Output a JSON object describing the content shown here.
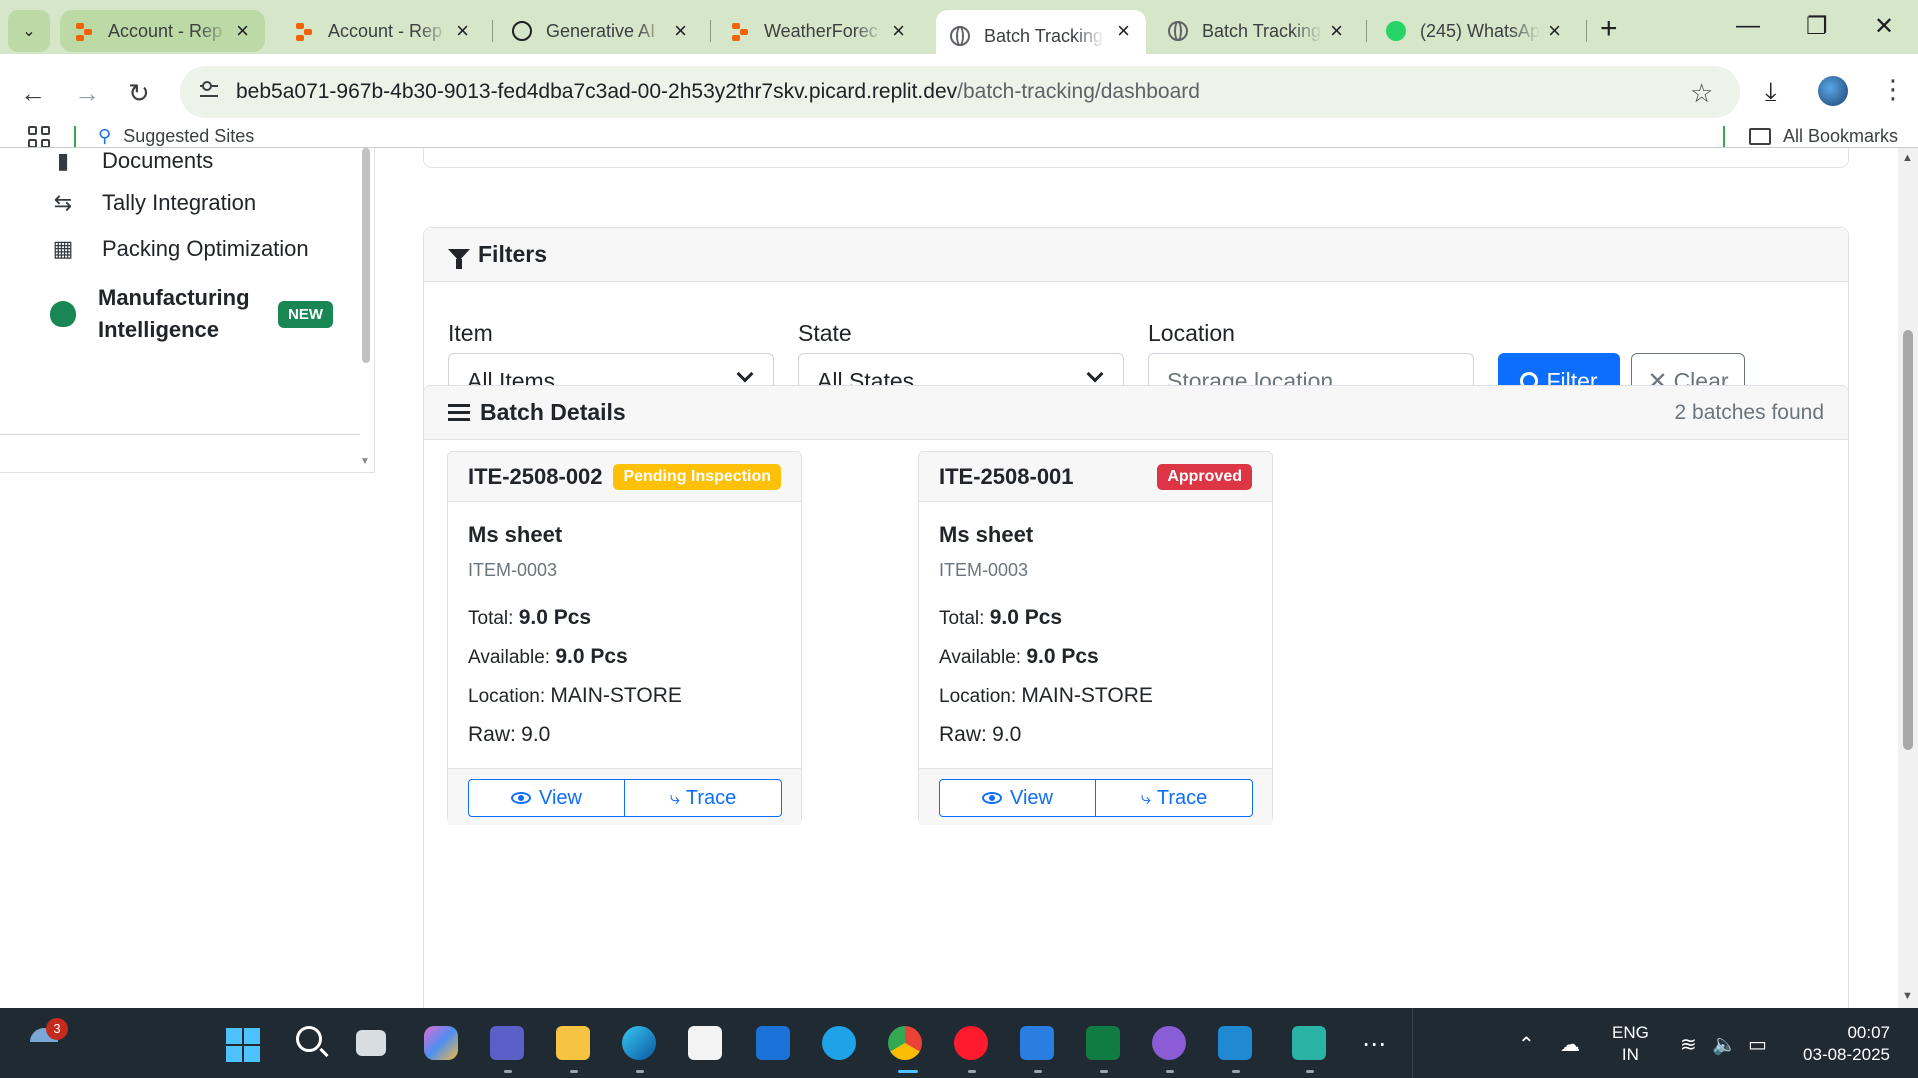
{
  "browser": {
    "tabs": [
      {
        "label": "Account - Rep",
        "icon": "replit-icon",
        "state": "highlighted"
      },
      {
        "label": "Account - Rep",
        "icon": "replit-icon",
        "state": "inactive"
      },
      {
        "label": "Generative AI",
        "icon": "openai-icon",
        "state": "inactive"
      },
      {
        "label": "WeatherForec",
        "icon": "replit-icon",
        "state": "inactive"
      },
      {
        "label": "Batch Tracking",
        "icon": "globe-icon",
        "state": "active"
      },
      {
        "label": "Batch Tracking",
        "icon": "globe-icon",
        "state": "inactive"
      },
      {
        "label": "(245) WhatsAp",
        "icon": "whatsapp-icon",
        "state": "inactive"
      }
    ],
    "url_host": "beb5a071-967b-4b30-9013-fed4dba7c3ad-00-2h53y2thr7skv.picard.replit.dev",
    "url_path": "/batch-tracking/dashboard",
    "bookmarks": {
      "suggested": "Suggested Sites",
      "all": "All Bookmarks"
    }
  },
  "sidebar": {
    "items": [
      {
        "label": "Documents",
        "icon": "file-icon"
      },
      {
        "label": "Tally Integration",
        "icon": "exchange-icon"
      },
      {
        "label": "Packing Optimization",
        "icon": "boxes-icon"
      }
    ],
    "mi_line1": "Manufacturing",
    "mi_line2": "Intelligence",
    "mi_badge": "NEW"
  },
  "filters": {
    "title": "Filters",
    "item_label": "Item",
    "item_value": "All Items",
    "state_label": "State",
    "state_value": "All States",
    "location_label": "Location",
    "location_placeholder": "Storage location",
    "filter_button": "Filter",
    "clear_button": "Clear"
  },
  "batch_details": {
    "title": "Batch Details",
    "count_text": "2 batches found",
    "batches": [
      {
        "batch_no": "ITE-2508-002",
        "status": "Pending Inspection",
        "status_color": "#ffc107",
        "item_name": "Ms sheet",
        "item_code": "ITEM-0003",
        "total_label": "Total:",
        "total": "9.0 Pcs",
        "available_label": "Available:",
        "available": "9.0 Pcs",
        "location_label": "Location:",
        "location": "MAIN-STORE",
        "raw_label": "Raw:",
        "raw": "9.0",
        "view": "View",
        "trace": "Trace"
      },
      {
        "batch_no": "ITE-2508-001",
        "status": "Approved",
        "status_color": "#dc3545",
        "item_name": "Ms sheet",
        "item_code": "ITEM-0003",
        "total_label": "Total:",
        "total": "9.0 Pcs",
        "available_label": "Available:",
        "available": "9.0 Pcs",
        "location_label": "Location:",
        "location": "MAIN-STORE",
        "raw_label": "Raw:",
        "raw": "9.0",
        "view": "View",
        "trace": "Trace"
      }
    ]
  },
  "taskbar": {
    "weather_badge": "3",
    "lang_line1": "ENG",
    "lang_line2": "IN",
    "time": "00:07",
    "date": "03-08-2025"
  },
  "colors": {
    "primary": "#0d6efd",
    "success": "#198754",
    "warning": "#ffc107",
    "danger": "#dc3545"
  }
}
